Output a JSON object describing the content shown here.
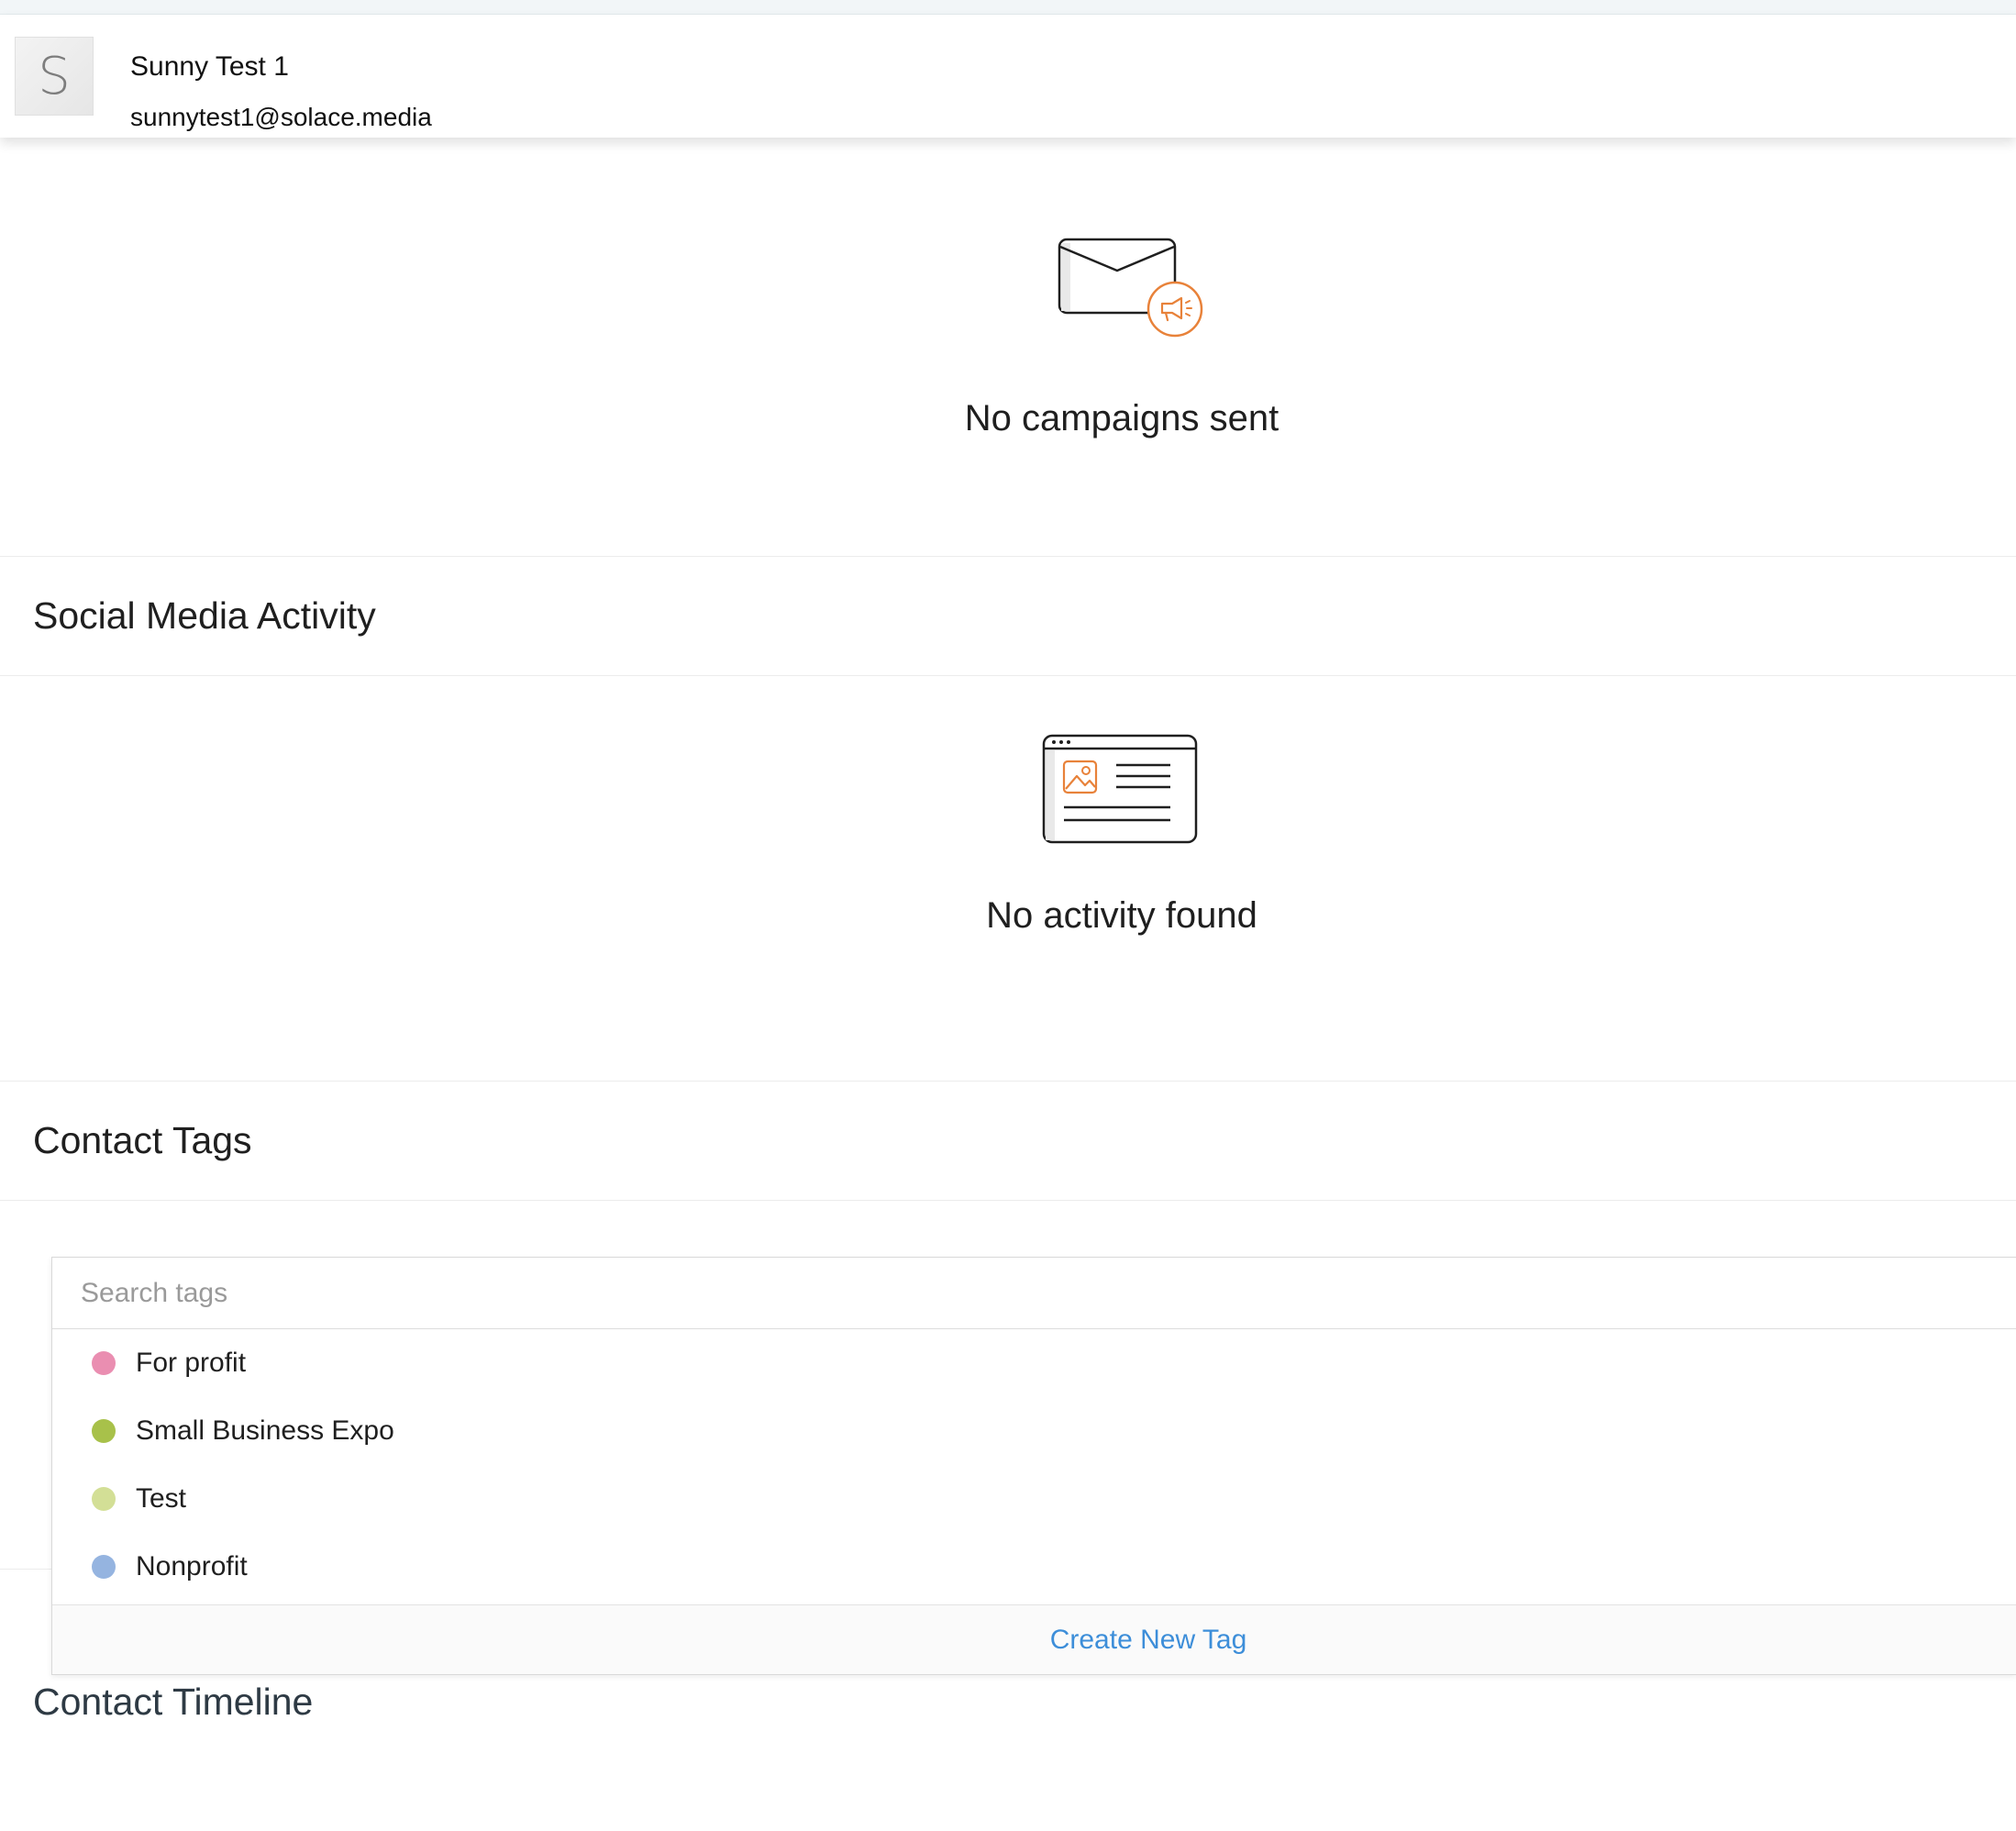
{
  "contact": {
    "avatar_letter": "S",
    "name": "Sunny Test 1",
    "email": "sunnytest1@solace.media"
  },
  "campaigns": {
    "icon": "envelope-megaphone-icon",
    "empty_text": "No campaigns sent"
  },
  "social": {
    "title": "Social Media Activity",
    "icon": "browser-post-icon",
    "empty_text": "No activity found"
  },
  "tags": {
    "title": "Contact Tags",
    "search_placeholder": "Search tags",
    "items": [
      {
        "label": "For profit",
        "color": "#ea8eb1"
      },
      {
        "label": "Small Business Expo",
        "color": "#a8c14a"
      },
      {
        "label": "Test",
        "color": "#d3df96"
      },
      {
        "label": "Nonprofit",
        "color": "#95b4e0"
      }
    ],
    "create_label": "Create New Tag"
  },
  "timeline": {
    "title": "Contact Timeline"
  },
  "colors": {
    "accent_orange": "#e8823a",
    "link_blue": "#3d8ed9"
  }
}
